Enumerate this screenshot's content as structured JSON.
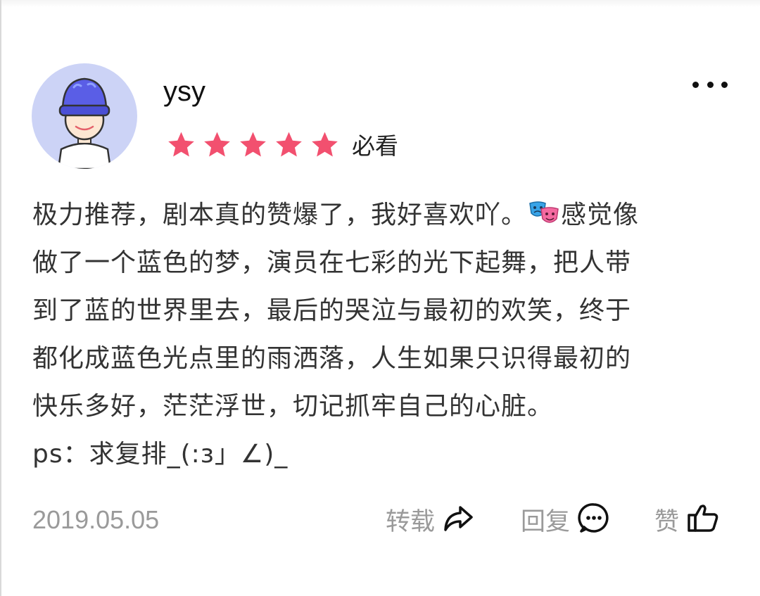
{
  "review": {
    "username": "ysy",
    "rating": 5,
    "rating_max": 5,
    "rating_label": "必看",
    "content_lines": [
      "极力推荐，剧本真的赞爆了，我好喜欢吖。",
      "感觉像",
      "做了一个蓝色的梦，演员在七彩的光下起舞，把人带",
      "到了蓝的世界里去，最后的哭泣与最初的欢笑，终于",
      "都化成蓝色光点里的雨洒落，人生如果只识得最初的",
      "快乐多好，茫茫浮世，切记抓牢自己的心脏。",
      "ps：求复排_(:з」∠)_"
    ],
    "date": "2019.05.05",
    "actions": {
      "share_label": "转载",
      "reply_label": "回复",
      "like_label": "赞"
    }
  },
  "icons": {
    "more": "more-dots-icon",
    "star": "star-icon",
    "emoji": "theater-masks-icon",
    "share": "share-arrow-icon",
    "reply": "comment-bubble-icon",
    "like": "thumbs-up-icon"
  },
  "colors": {
    "star": "#f2506f",
    "avatar_bg": "#ccd3f6",
    "cap": "#5a5ee6",
    "muted_text": "#9a9a9a"
  }
}
